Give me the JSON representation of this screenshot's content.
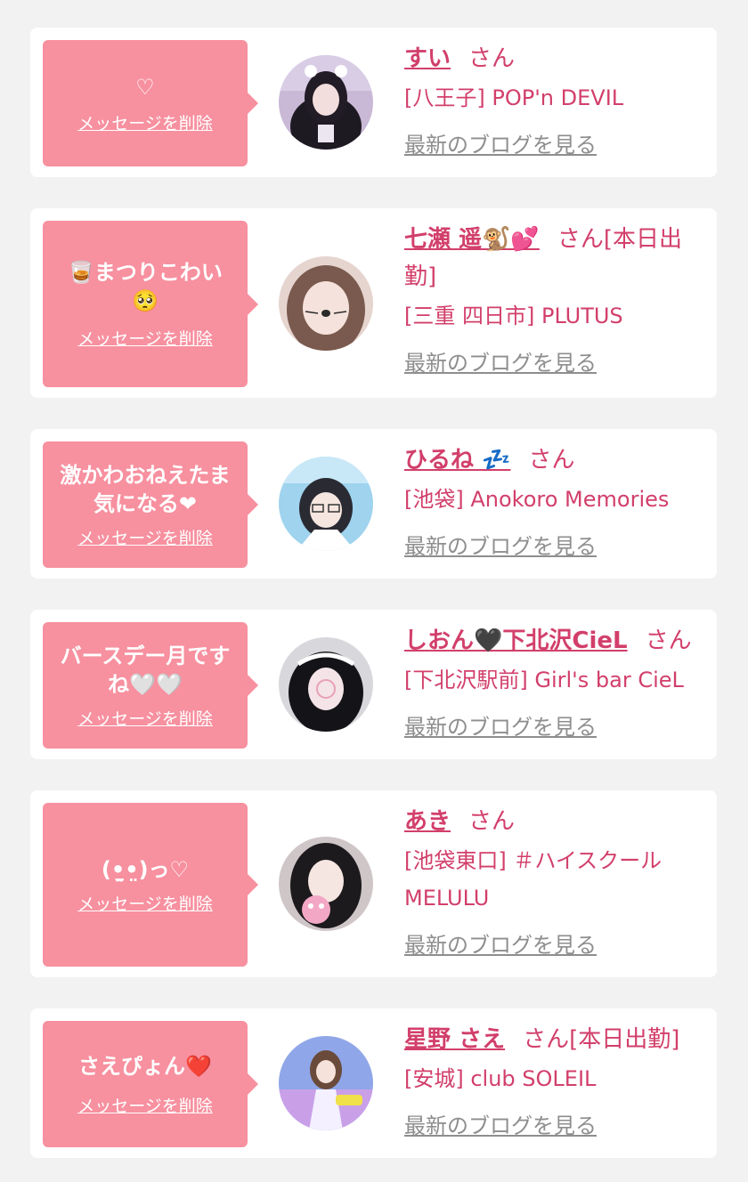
{
  "delete_label": "メッセージを削除",
  "blog_label": "最新のブログを見る",
  "san_label": "さん",
  "colors": {
    "bubble": "#f7909f",
    "accent": "#d23f6b",
    "link_gray": "#8e8e8e",
    "background": "#f2f2f2"
  },
  "messages": [
    {
      "message": "♡",
      "name": "すい",
      "suffix": "",
      "shop": "[八王子] POP'n DEVIL"
    },
    {
      "message": "🥃まつりこわい🥺",
      "name": "七瀬 遥🐒💕",
      "suffix": "[本日出勤]",
      "shop": "[三重 四日市] PLUTUS"
    },
    {
      "message": "激かわおねえたま気になる❤",
      "name": "ひるね 💤",
      "suffix": "",
      "shop": "[池袋] Anokoro Memories"
    },
    {
      "message": "バースデー月ですね🤍🤍",
      "name": "しおん🖤下北沢CieL",
      "suffix": "",
      "shop": "[下北沢駅前] Girl's bar CieL"
    },
    {
      "message": "(•̤̫•̤)っ♡",
      "name": "あき",
      "suffix": "",
      "shop": "[池袋東口] ＃ハイスクール MELULU"
    },
    {
      "message": "さえぴょん❤️",
      "name": "星野 さえ",
      "suffix": "[本日出勤]",
      "shop": "[安城] club SOLEIL"
    }
  ]
}
